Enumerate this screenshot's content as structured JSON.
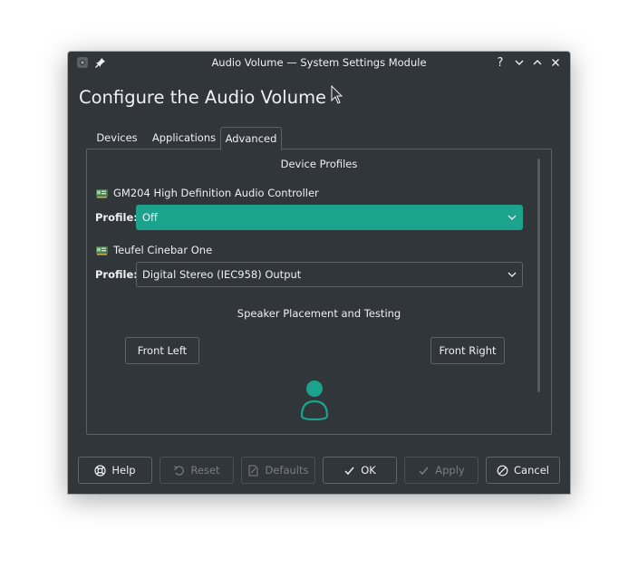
{
  "window": {
    "title": "Audio Volume — System Settings Module",
    "help_glyph": "?"
  },
  "heading": "Configure the Audio Volume",
  "tabs": [
    {
      "label": "Devices"
    },
    {
      "label": "Applications"
    },
    {
      "label": "Advanced",
      "active": true
    }
  ],
  "advanced": {
    "device_profiles_title": "Device Profiles",
    "devices": [
      {
        "name": "GM204 High Definition Audio Controller",
        "profile_label": "Profile:",
        "profile_value": "Off"
      },
      {
        "name": "Teufel Cinebar One",
        "profile_label": "Profile:",
        "profile_value": "Digital Stereo (IEC958) Output"
      }
    ],
    "speaker_title": "Speaker Placement and Testing",
    "front_left": "Front Left",
    "front_right": "Front Right"
  },
  "buttons": {
    "help": "Help",
    "reset": "Reset",
    "defaults": "Defaults",
    "ok": "OK",
    "apply": "Apply",
    "cancel": "Cancel"
  },
  "colors": {
    "window_bg": "#31363b",
    "accent": "#1ba38e",
    "text": "#eff0f1",
    "disabled_text": "#7a7e82"
  },
  "icons": [
    "window-menu-icon",
    "pin-icon",
    "help-icon",
    "minimize-icon",
    "maximize-icon",
    "close-icon",
    "sound-card-icon",
    "chevron-down-icon",
    "listener-icon",
    "help-lifebuoy-icon",
    "reset-icon",
    "defaults-icon",
    "checkmark-icon",
    "cancel-icon",
    "mouse-cursor-icon"
  ]
}
